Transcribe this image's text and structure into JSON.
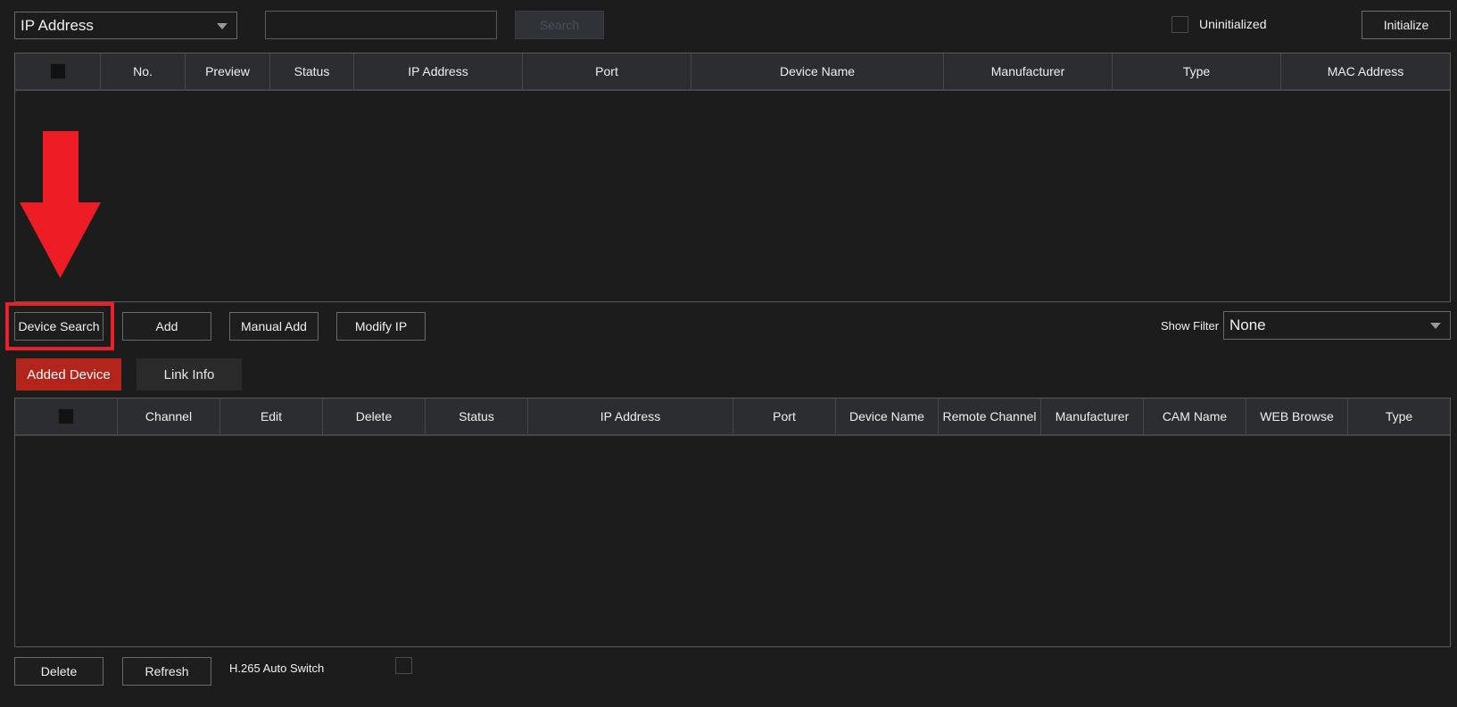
{
  "toolbar": {
    "filter_select_value": "IP Address",
    "search_input_value": "",
    "search_label": "Search",
    "uninitialized_label": "Uninitialized",
    "initialize_label": "Initialize"
  },
  "search_table": {
    "columns": [
      "No.",
      "Preview",
      "Status",
      "IP Address",
      "Port",
      "Device Name",
      "Manufacturer",
      "Type",
      "MAC Address"
    ],
    "rows": []
  },
  "actions": {
    "device_search_label": "Device Search",
    "add_label": "Add",
    "manual_add_label": "Manual Add",
    "modify_ip_label": "Modify IP",
    "show_filter_label": "Show Filter",
    "show_filter_value": "None"
  },
  "tabs": {
    "added_device": "Added Device",
    "link_info": "Link Info",
    "active": "added_device"
  },
  "added_table": {
    "columns": [
      "Channel",
      "Edit",
      "Delete",
      "Status",
      "IP Address",
      "Port",
      "Device Name",
      "Remote Channel",
      "Manufacturer",
      "CAM Name",
      "WEB Browse",
      "Type"
    ],
    "rows": []
  },
  "footer": {
    "delete_label": "Delete",
    "refresh_label": "Refresh",
    "h265_label": "H.265 Auto Switch"
  },
  "annotation": {
    "arrow_color": "#ee1c25",
    "highlight_color": "#e8212b",
    "arrow_icon": "down-arrow-icon"
  },
  "colors": {
    "background": "#1c1c1c",
    "header": "#2c2d31",
    "active_tab": "#b3241b"
  }
}
